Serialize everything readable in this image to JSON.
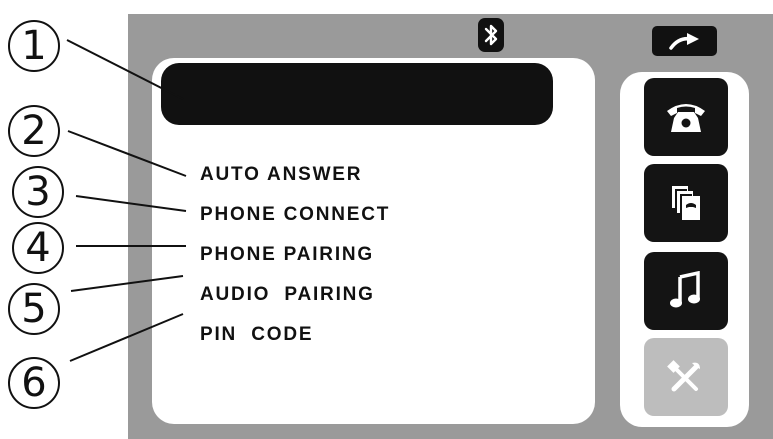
{
  "menu": {
    "items": [
      {
        "label": "AUTO ANSWER"
      },
      {
        "label": "PHONE CONNECT"
      },
      {
        "label": "PHONE PAIRING"
      },
      {
        "label": "AUDIO  PAIRING"
      },
      {
        "label": "PIN  CODE"
      }
    ]
  },
  "status": {
    "bluetooth_icon": "bluetooth-icon"
  },
  "top_bar": {
    "back_icon": "back-arrow-icon"
  },
  "side_menu": [
    {
      "icon": "telephone-icon",
      "state": "dark"
    },
    {
      "icon": "phonebook-icon",
      "state": "dark"
    },
    {
      "icon": "music-note-icon",
      "state": "dark"
    },
    {
      "icon": "settings-tools-icon",
      "state": "selected"
    }
  ],
  "callouts": [
    "1",
    "2",
    "3",
    "4",
    "5",
    "6"
  ],
  "colors": {
    "background": "#9a9a9a",
    "panel": "#ffffff",
    "button_dark": "#141414",
    "button_selected": "#bdbdbd"
  }
}
